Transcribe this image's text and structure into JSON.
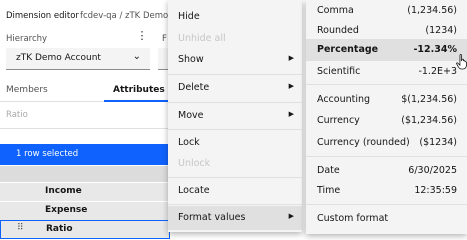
{
  "editor": {
    "title": "Dimension editor",
    "breadcrumb": "fcdev-qa / zTK Demo Account",
    "hierarchy_label": "Hierarchy",
    "hierarchy_value": "zTK Demo Account",
    "second_field_label": "F",
    "tabs": {
      "members": "Members",
      "attributes": "Attributes"
    },
    "ratio_placeholder": "Ratio",
    "selection_text": "1 row selected",
    "rows": [
      "Income",
      "Expense",
      "Ratio"
    ]
  },
  "context_menu": {
    "items": {
      "hide": "Hide",
      "unhide_all": "Unhide all",
      "show": "Show",
      "delete": "Delete",
      "move": "Move",
      "lock": "Lock",
      "unlock": "Unlock",
      "locate": "Locate",
      "format_values": "Format values"
    }
  },
  "format_submenu": {
    "items": [
      {
        "name": "Comma",
        "sample": "(1,234.56)"
      },
      {
        "name": "Rounded",
        "sample": "(1234)"
      },
      {
        "name": "Percentage",
        "sample": "-12.34%"
      },
      {
        "name": "Scientific",
        "sample": "-1.2E+3"
      },
      {
        "name": "Accounting",
        "sample": "$(1,234.56)"
      },
      {
        "name": "Currency",
        "sample": "($1,234.56)"
      },
      {
        "name": "Currency (rounded)",
        "sample": "($1234)"
      },
      {
        "name": "Date",
        "sample": "6/30/2025"
      },
      {
        "name": "Time",
        "sample": "12:35:59"
      },
      {
        "name": "Custom format",
        "sample": ""
      }
    ],
    "highlighted": "Percentage"
  },
  "colors": {
    "accent": "#0f62fe",
    "menu_bg": "#f4f4f4",
    "hover_bg": "#e0e0e0",
    "disabled_text": "#c6c6c6"
  }
}
